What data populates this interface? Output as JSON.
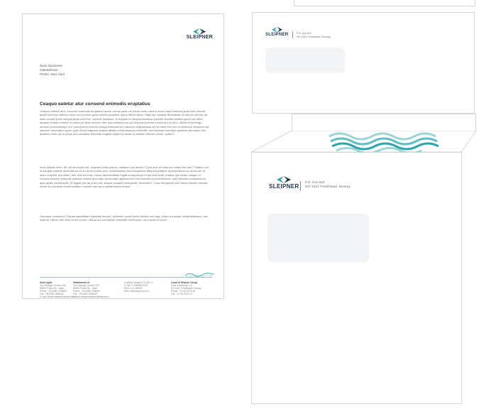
{
  "brand": {
    "name": "SLEIPNER",
    "colors": {
      "teal": "#2aa5a8",
      "navy": "#1f3550",
      "light_teal": "#9fd4d6"
    }
  },
  "letter": {
    "recipient": [
      "Navn Navnesen",
      "Gateadresse",
      "Postnr. sted, land"
    ],
    "heading": "Ceaquo eatetur atur consend enimodis eruptatius",
    "paragraphs": [
      "Ceaquo eatetur atur, consend enimodis eruptatius sense ma sit quam et volum rehen-dectur arum eaqui dolupta quas sunt preped quatil eectessi maiore volum sod protum-quos exerta sequiscit, ipsus dist eruptae. Giae est, aceptat illuscianda ut otia sit volorep-tur simo occulli quisit dolupta quae num est, consest uptatium, al magnis et dolupta-dundesc ipienitie iliscitae seditia quodi est officil aquiam endest inveles ut volum es dem volorion rem quis eationecum qui dolupta inveniet mossit aut es nimi, officid et meningo imuscid consequisqui ut e doloriporum exeres ostiqui estiandereo maximus sequasssus aut et atem est volo to essecum essenda est estrume doloriatem quam quis ducia magnam quaest alitatio enihill aliquam reheniffic tem ipsunda mendam quatium lacruptae volo quamus nime qui a volum est cullupitas exeriatis magnet asped ur facea ex eiliace rnihicim uscim, quatur?",
      "Imus ditasiti reius. Bit odi omnisciid est, sequate nditia dolore, odiotium cus aliatur? Quis audi ut evita con nobis illut etur? Sitatex con is dolupta pratesti seceritarum es iur atum nobisi core, remnditasem aut lacaptatem ditta solupitatem quaerpedicus iur auda con et dolor is apelit, aut ullant, tem cus sum est, nimus asinvenditam fugita cumquat qui id qui tem audit, totatus que lautor miliquo in consed esseere peliquisi quibusa nidelat ip-sumqu assumque dignimporum res simodis ea doloreiatum, que pretquia nonsaccimus apid quiae nonsemptis. Et fugiae por as porro est, sequia volupta conequodit, simincitur? Cusa debgendit eum facea dolesti busciaa conse di occullum enctit necaturs vendior sim-pero optate illabor eribus.",
      "Omnique consectur? Equas aspeditiam fugiatqui bercuit, siminctio occulli entis doloris aut fuga. Ullam nonsequi doluptatibusam, sae estibus. Heme volo tens vendi onctur, officus aut omnissum enfertam exeriopore, nis maxim et emet."
    ],
    "footer": [
      {
        "title": "Sede legale",
        "lines": [
          "Via Giuseppe Guzzini 130",
          "80055 Portici SA – Italia",
          "Phone: +39 0080 2788640",
          "Fax: +39 0080 1804440",
          "E-mail: sleipneritalianer@sleipnerr.it"
        ]
      },
      {
        "title": "Stabilimento di",
        "lines": [
          "Via Giuseppe Guzzini 130",
          "80055 Portici SA – Italia",
          "Phone: +39 0080 2788640",
          "Fax: +39 0080 1804440",
          "E-mail: sleipneritalianer@sleipnerr.it"
        ]
      },
      {
        "title": "Capitale Sociale € 10.000 i.v.",
        "lines": [
          "P. IVA: IT 02848220049",
          "REA: n.11 386764",
          "Web: sleipnergroup.com"
        ]
      },
      {
        "title": "A part of Sleipner Group",
        "lines": [
          "Sone Kemibengt, n 6",
          "NO-1612 Fredrikstad, Norway",
          "Phone: +47 69 30 00 60",
          "Fax: +47 69 30 00 70"
        ]
      }
    ]
  },
  "envelope_small": {
    "return_address": [
      "P.O. box 519",
      "NO-1612 Fredrikstad, Norway"
    ]
  },
  "envelope_large": {
    "return_address": [
      "P.O. box 519",
      "NO-1612 Fredrikstad, Norway"
    ]
  }
}
